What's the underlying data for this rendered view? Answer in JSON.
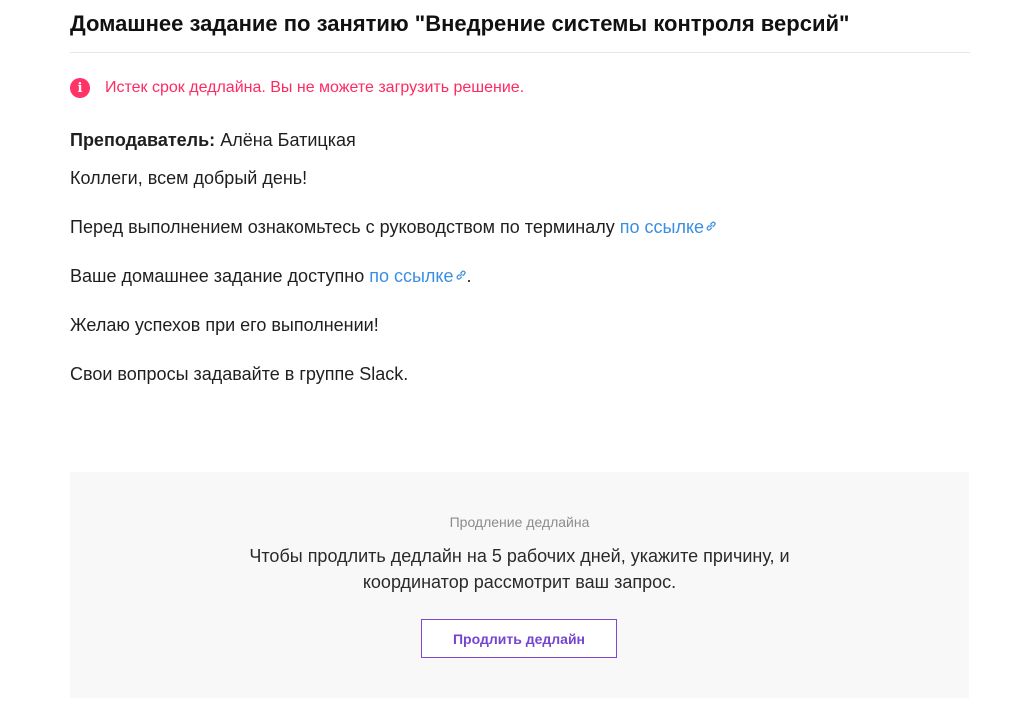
{
  "header": {
    "title": "Домашнее задание по занятию \"Внедрение системы контроля версий\""
  },
  "alert": {
    "icon": "info-icon",
    "text": "Истек срок дедлайна. Вы не можете загрузить решение.",
    "color": "#ff2a60"
  },
  "content": {
    "teacher_label": "Преподаватель:",
    "teacher_name": "Алёна Батицкая",
    "greeting": "Коллеги, всем добрый день!",
    "line_terminal_prefix": "Перед выполнением ознакомьтесь с руководством по терминалу",
    "line_terminal_link": "по ссылке",
    "line_homework_prefix": "Ваше домашнее задание доступно",
    "line_homework_link": "по ссылке",
    "line_homework_suffix": ".",
    "wish": "Желаю успехов при его выполнении!",
    "questions": "Свои вопросы задавайте в группе Slack.",
    "link_color": "#3a8fe0"
  },
  "deadline_panel": {
    "label": "Продление дедлайна",
    "text_line1": "Чтобы продлить дедлайн на 5 рабочих дней, укажите причину, и",
    "text_line2": "координатор рассмотрит ваш запрос.",
    "button_label": "Продлить дедлайн",
    "accent_color": "#7445d0"
  }
}
